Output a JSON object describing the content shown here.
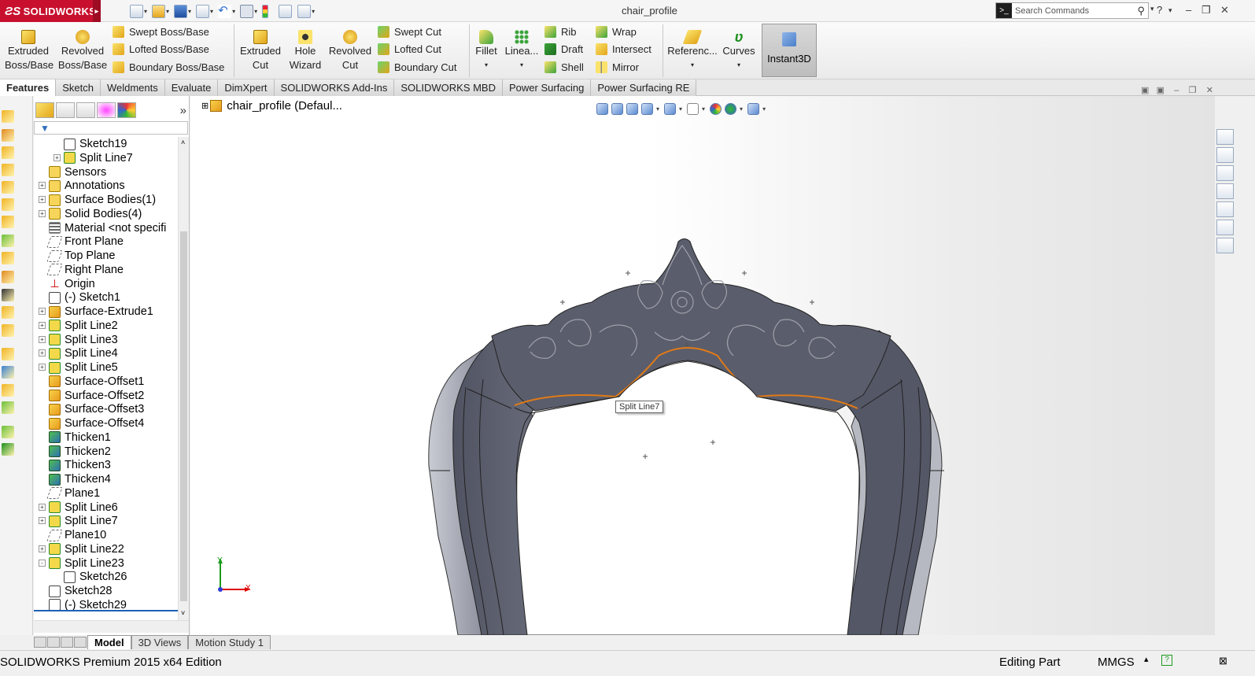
{
  "app": {
    "logo": "SOLIDWORKS",
    "document_title": "chair_profile",
    "search_placeholder": "Search Commands"
  },
  "command_manager": {
    "features_group1": [
      {
        "label": "Extruded Boss/Base",
        "icon": "extruded-boss-icon"
      },
      {
        "label": "Revolved Boss/Base",
        "icon": "revolved-boss-icon"
      }
    ],
    "boss_small": [
      "Swept Boss/Base",
      "Lofted Boss/Base",
      "Boundary Boss/Base"
    ],
    "cut_group": [
      {
        "label": "Extruded Cut",
        "icon": "extruded-cut-icon"
      },
      {
        "label": "Hole Wizard",
        "icon": "hole-wizard-icon"
      },
      {
        "label": "Revolved Cut",
        "icon": "revolved-cut-icon"
      }
    ],
    "cut_small": [
      "Swept Cut",
      "Lofted Cut",
      "Boundary Cut"
    ],
    "fillet": "Fillet",
    "linear": "Linea...",
    "ops_small": [
      "Rib",
      "Draft",
      "Shell"
    ],
    "ops_small2": [
      "Wrap",
      "Intersect",
      "Mirror"
    ],
    "reference": "Referenc...",
    "curves": "Curves",
    "instant3d": "Instant3D"
  },
  "tabs": [
    "Features",
    "Sketch",
    "Weldments",
    "Evaluate",
    "DimXpert",
    "SOLIDWORKS Add-Ins",
    "SOLIDWORKS MBD",
    "Power Surfacing",
    "Power Surfacing RE"
  ],
  "feature_tree": [
    {
      "label": "Sketch19",
      "icon": "sketch",
      "indent": 1,
      "expander": ""
    },
    {
      "label": "Split Line7",
      "icon": "splitline",
      "indent": 1,
      "expander": "+"
    },
    {
      "label": "Sensors",
      "icon": "folder",
      "indent": 0,
      "expander": ""
    },
    {
      "label": "Annotations",
      "icon": "folder",
      "indent": 0,
      "expander": "+"
    },
    {
      "label": "Surface Bodies(1)",
      "icon": "folder",
      "indent": 0,
      "expander": "+"
    },
    {
      "label": "Solid Bodies(4)",
      "icon": "folder",
      "indent": 0,
      "expander": "+"
    },
    {
      "label": "Material <not specifi",
      "icon": "material",
      "indent": 0,
      "expander": ""
    },
    {
      "label": "Front Plane",
      "icon": "plane",
      "indent": 0,
      "expander": ""
    },
    {
      "label": "Top Plane",
      "icon": "plane",
      "indent": 0,
      "expander": ""
    },
    {
      "label": "Right Plane",
      "icon": "plane",
      "indent": 0,
      "expander": ""
    },
    {
      "label": "Origin",
      "icon": "origin",
      "indent": 0,
      "expander": ""
    },
    {
      "label": "(-) Sketch1",
      "icon": "sketch",
      "indent": 0,
      "expander": ""
    },
    {
      "label": "Surface-Extrude1",
      "icon": "surface",
      "indent": 0,
      "expander": "+"
    },
    {
      "label": "Split Line2",
      "icon": "splitline",
      "indent": 0,
      "expander": "+"
    },
    {
      "label": "Split Line3",
      "icon": "splitline",
      "indent": 0,
      "expander": "+"
    },
    {
      "label": "Split Line4",
      "icon": "splitline",
      "indent": 0,
      "expander": "+"
    },
    {
      "label": "Split Line5",
      "icon": "splitline",
      "indent": 0,
      "expander": "+"
    },
    {
      "label": "Surface-Offset1",
      "icon": "surface",
      "indent": 0,
      "expander": ""
    },
    {
      "label": "Surface-Offset2",
      "icon": "surface",
      "indent": 0,
      "expander": ""
    },
    {
      "label": "Surface-Offset3",
      "icon": "surface",
      "indent": 0,
      "expander": ""
    },
    {
      "label": "Surface-Offset4",
      "icon": "surface",
      "indent": 0,
      "expander": ""
    },
    {
      "label": "Thicken1",
      "icon": "thicken",
      "indent": 0,
      "expander": ""
    },
    {
      "label": "Thicken2",
      "icon": "thicken",
      "indent": 0,
      "expander": ""
    },
    {
      "label": "Thicken3",
      "icon": "thicken",
      "indent": 0,
      "expander": ""
    },
    {
      "label": "Thicken4",
      "icon": "thicken",
      "indent": 0,
      "expander": ""
    },
    {
      "label": "Plane1",
      "icon": "plane",
      "indent": 0,
      "expander": ""
    },
    {
      "label": "Split Line6",
      "icon": "splitline",
      "indent": 0,
      "expander": "+"
    },
    {
      "label": "Split Line7",
      "icon": "splitline",
      "indent": 0,
      "expander": "+"
    },
    {
      "label": "Plane10",
      "icon": "plane",
      "indent": 0,
      "expander": ""
    },
    {
      "label": "Split Line22",
      "icon": "splitline",
      "indent": 0,
      "expander": "+"
    },
    {
      "label": "Split Line23",
      "icon": "splitline",
      "indent": 0,
      "expander": "-"
    },
    {
      "label": "Sketch26",
      "icon": "sketch",
      "indent": 1,
      "expander": ""
    },
    {
      "label": "Sketch28",
      "icon": "sketch",
      "indent": 0,
      "expander": ""
    },
    {
      "label": "(-) Sketch29",
      "icon": "sketch",
      "indent": 0,
      "expander": ""
    }
  ],
  "viewport": {
    "part_title": "chair_profile  (Defaul...",
    "tooltip": "Split Line7",
    "triad_x": "X",
    "triad_y": "Y"
  },
  "bottom_tabs": [
    "Model",
    "3D Views",
    "Motion Study 1"
  ],
  "status": {
    "edition": "SOLIDWORKS Premium 2015 x64 Edition",
    "mode": "Editing Part",
    "units": "MMGS"
  },
  "colors": {
    "brand": "#c8102e",
    "model_dark": "#585b69",
    "model_light": "#c9cbd3",
    "selection": "#e07a17"
  }
}
